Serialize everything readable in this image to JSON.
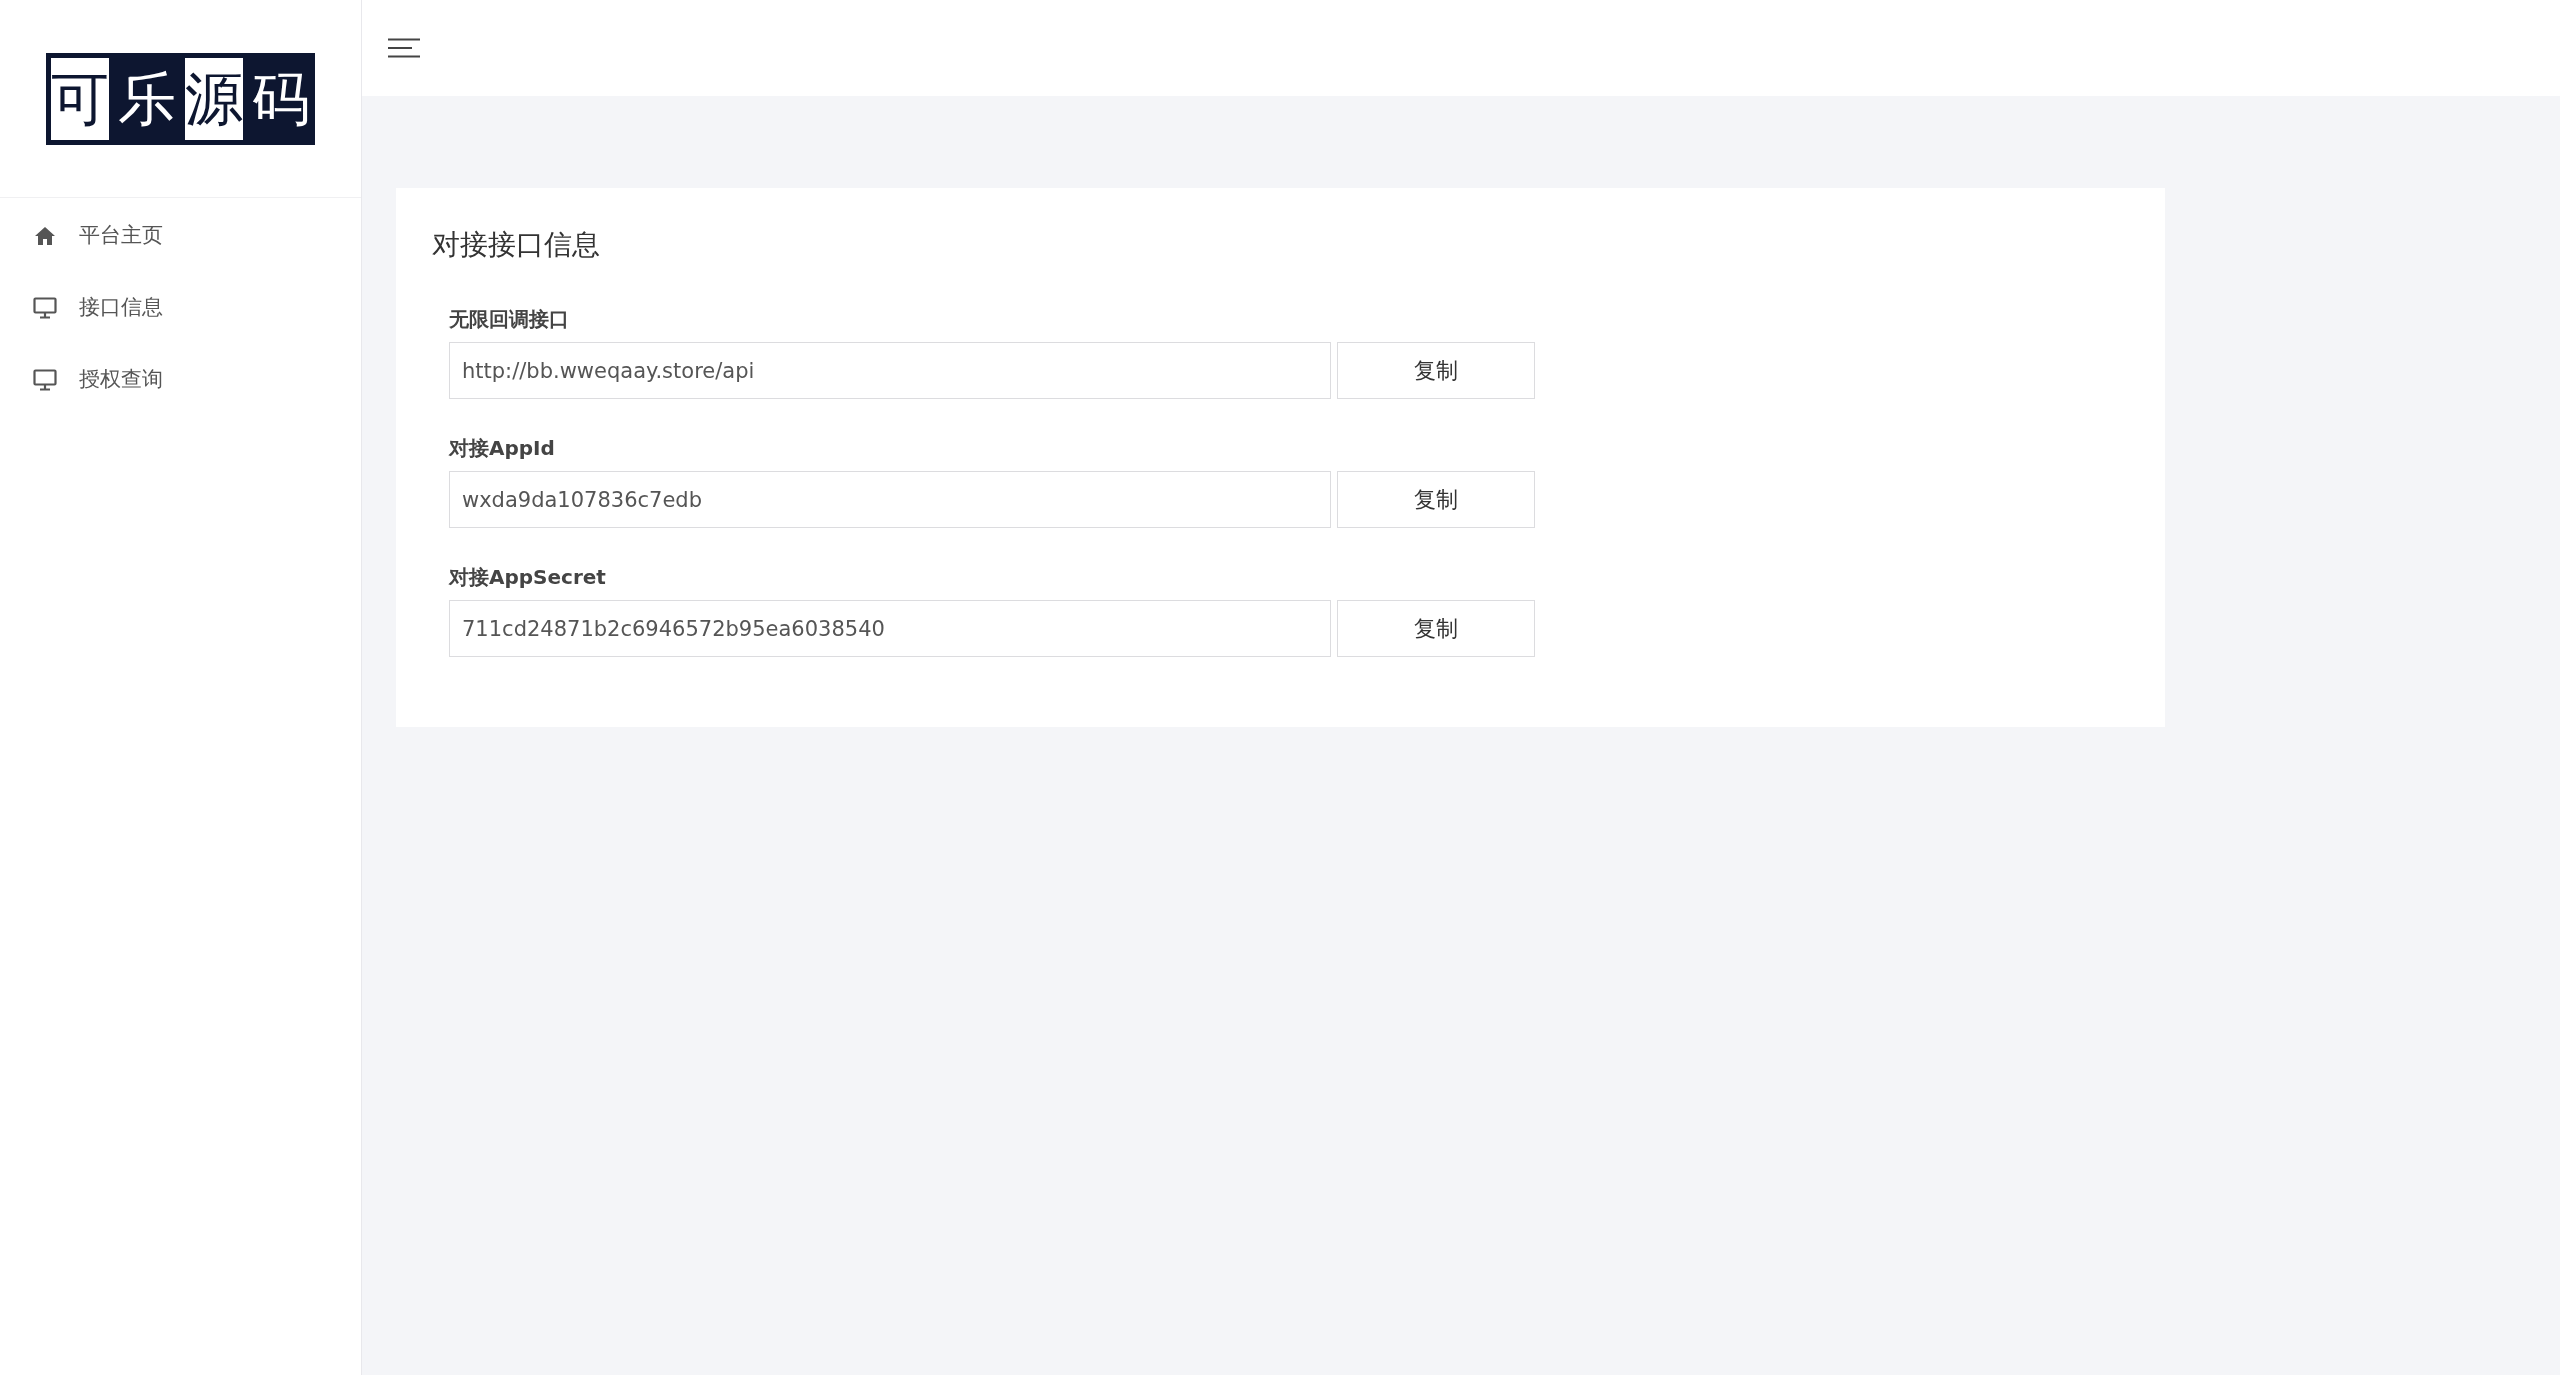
{
  "logo": [
    {
      "char": "可",
      "inverted": false
    },
    {
      "char": "乐",
      "inverted": true
    },
    {
      "char": "源",
      "inverted": false
    },
    {
      "char": "码",
      "inverted": true
    }
  ],
  "sidebar": {
    "items": [
      {
        "label": "平台主页",
        "kind": "home"
      },
      {
        "label": "接口信息",
        "kind": "page"
      },
      {
        "label": "授权查询",
        "kind": "page"
      }
    ]
  },
  "card": {
    "title": "对接接口信息",
    "fields": [
      {
        "label": "无限回调接口",
        "value": "http://bb.wweqaay.store/api",
        "button": "复制"
      },
      {
        "label": "对接AppId",
        "value": "wxda9da107836c7edb",
        "button": "复制"
      },
      {
        "label": "对接AppSecret",
        "value": "711cd24871b2c6946572b95ea6038540",
        "button": "复制"
      }
    ]
  }
}
